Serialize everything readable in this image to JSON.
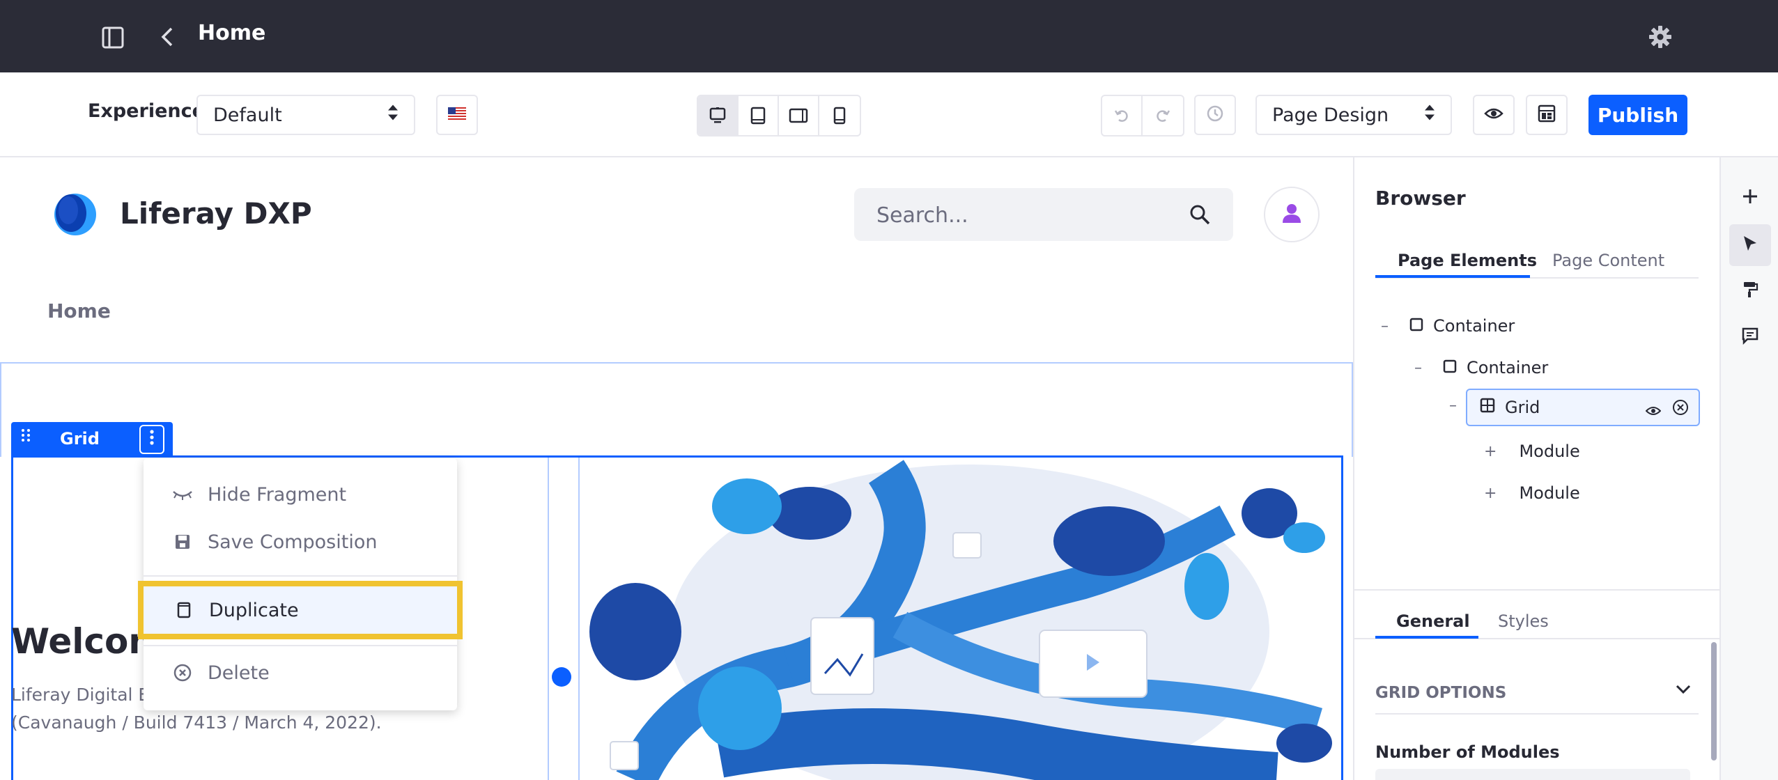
{
  "header": {
    "title": "Home",
    "icons": [
      "sidebar-toggle-icon",
      "back-chevron-icon",
      "gear-icon"
    ]
  },
  "toolbar": {
    "experience_label": "Experience",
    "experience_value": "Default",
    "language_flag": "en-US",
    "view_modes": [
      "desktop",
      "tablet",
      "landscape-phone",
      "portrait-phone"
    ],
    "page_mode_value": "Page Design",
    "publish_label": "Publish"
  },
  "site": {
    "name": "Liferay DXP",
    "search_placeholder": "Search...",
    "nav_home": "Home"
  },
  "fragment": {
    "topper_label": "Grid",
    "menu": {
      "hide": "Hide Fragment",
      "save": "Save Composition",
      "duplicate": "Duplicate",
      "delete": "Delete"
    },
    "welcome": "Welcom",
    "desc_line1": "Liferay Digital E",
    "desc_line2": "(Cavanaugh / Build 7413 / March 4, 2022)."
  },
  "browser": {
    "title": "Browser",
    "tabs": [
      "Page Elements",
      "Page Content"
    ],
    "tree": [
      {
        "label": "Container",
        "depth": 0
      },
      {
        "label": "Container",
        "depth": 1
      },
      {
        "label": "Grid",
        "depth": 2
      },
      {
        "label": "Module",
        "depth": 3
      },
      {
        "label": "Module",
        "depth": 3
      }
    ],
    "config_tabs": [
      "General",
      "Styles"
    ],
    "section": "GRID OPTIONS",
    "field_label": "Number of Modules"
  },
  "colors": {
    "primary": "#0b5fff",
    "topbar": "#2b2c37",
    "highlight": "#f0c330"
  }
}
